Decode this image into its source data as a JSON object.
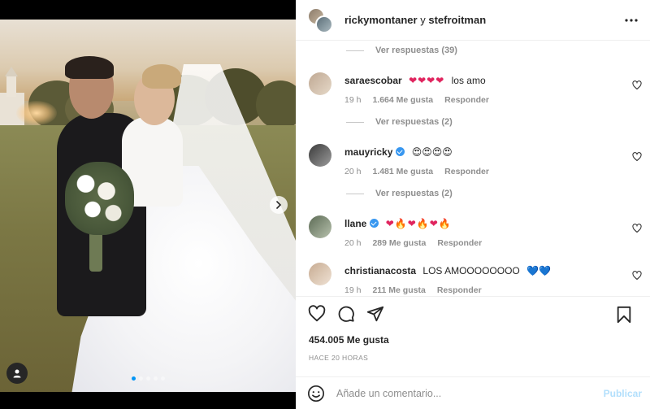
{
  "post": {
    "header": {
      "user1": "rickymontaner",
      "connector": "y",
      "user2": "stefroitman"
    },
    "media": {
      "slide_count": 5,
      "active_slide": 1
    }
  },
  "comments": {
    "replies_label_1": "Ver respuestas (39)",
    "items": [
      {
        "user": "saraescobar",
        "verified": false,
        "emoji": "❤❤❤❤",
        "text": "los amo",
        "time": "19 h",
        "likes": "1.664 Me gusta",
        "reply": "Responder",
        "replies_label": "Ver respuestas (2)"
      },
      {
        "user": "mauyricky",
        "verified": true,
        "emoji": "😍😍😍😍",
        "text": "",
        "time": "20 h",
        "likes": "1.481 Me gusta",
        "reply": "Responder",
        "replies_label": "Ver respuestas (2)"
      },
      {
        "user": "llane",
        "verified": true,
        "emoji": "❤🔥❤🔥❤🔥",
        "text": "",
        "time": "20 h",
        "likes": "289 Me gusta",
        "reply": "Responder"
      },
      {
        "user": "christianacosta",
        "verified": false,
        "emoji": "💙💙",
        "text": "LOS AMOOOOOOOO",
        "time": "19 h",
        "likes": "211 Me gusta",
        "reply": "Responder"
      }
    ]
  },
  "footer": {
    "likes": "454.005 Me gusta",
    "time_ago": "HACE 20 HORAS",
    "comment_placeholder": "Añade un comentario...",
    "publish": "Publicar"
  },
  "icons": {
    "like": "heart-icon",
    "comment": "comment-icon",
    "share": "paper-plane-icon",
    "save": "bookmark-icon",
    "more": "more-horizontal-icon",
    "emoji": "smiley-icon",
    "next": "chevron-right-icon",
    "tag": "user-tag-icon"
  },
  "colors": {
    "accent": "#0095f6",
    "verified": "#3897f0",
    "publish_disabled": "#b2dffc",
    "muted": "#8e8e8e"
  }
}
